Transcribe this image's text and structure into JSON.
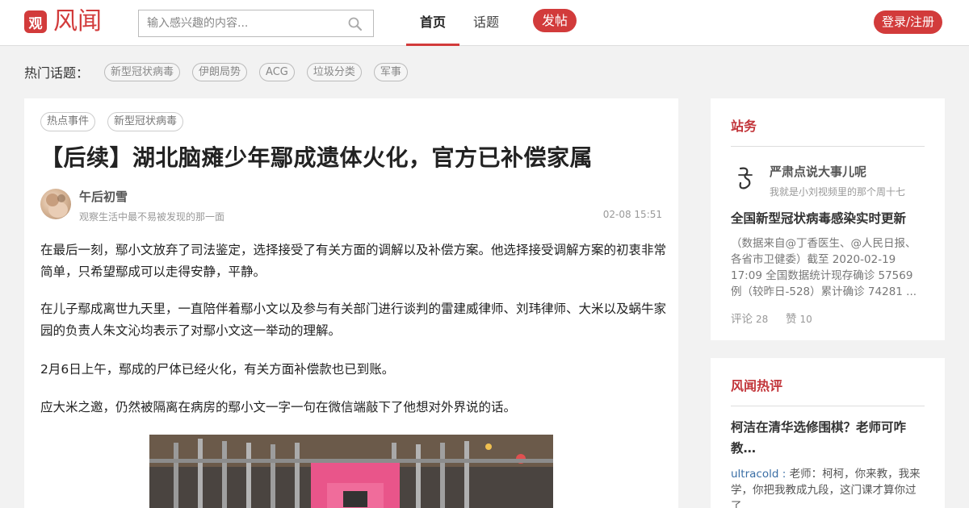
{
  "header": {
    "logo_badge": "观",
    "logo_text": "风闻",
    "search_placeholder": "输入感兴趣的内容...",
    "nav": [
      {
        "label": "首页",
        "active": true
      },
      {
        "label": "话题",
        "active": false
      }
    ],
    "post_label": "发帖",
    "login_label": "登录/注册",
    "accent_color": "#d23b3b"
  },
  "hot_topics": {
    "label": "热门话题：",
    "items": [
      "新型冠状病毒",
      "伊朗局势",
      "ACG",
      "垃圾分类",
      "军事"
    ]
  },
  "article": {
    "tags": [
      "热点事件",
      "新型冠状病毒"
    ],
    "title": "【后续】湖北脑瘫少年鄢成遗体火化，官方已补偿家属",
    "author": {
      "name": "午后初雪",
      "bio": "观察生活中最不易被发现的那一面"
    },
    "time": "02-08 15:51",
    "paragraphs": [
      "在最后一刻，鄢小文放弃了司法鉴定，选择接受了有关方面的调解以及补偿方案。他选择接受调解方案的初衷非常简单，只希望鄢成可以走得安静，平静。",
      "在儿子鄢成离世九天里，一直陪伴着鄢小文以及参与有关部门进行谈判的雷建威律师、刘玮律师、大米以及蜗牛家园的负责人朱文沁均表示了对鄢小文这一举动的理解。",
      "2月6日上午，鄢成的尸体已经火化，有关方面补偿款也已到账。",
      "应大米之邀，仍然被隔离在病房的鄢小文一字一句在微信端敲下了他想对外界说的话。"
    ]
  },
  "sidebar": {
    "station": {
      "title": "站务",
      "channel_name": "严肃点说大事儿呢",
      "channel_desc": "我就是小刘视频里的那个周十七",
      "headline": "全国新型冠状病毒感染实时更新",
      "excerpt": "（数据来自@丁香医生、@人民日报、各省市卫健委）截至 2020-02-19 17:09 全国数据统计现存确诊 57569 例（较昨日-528）累计确诊 74281 ...",
      "comments_label": "评论",
      "comments_count": "28",
      "likes_label": "赞",
      "likes_count": "10"
    },
    "hot_comments": {
      "title": "风闻热评",
      "headline": "柯洁在清华选修围棋？老师可咋教…",
      "comment_user": "ultracold",
      "comment_sep": " : ",
      "comment_text": "老师：柯柯，你来教，我来学，你把我教成九段，这门课才算你过了"
    }
  }
}
